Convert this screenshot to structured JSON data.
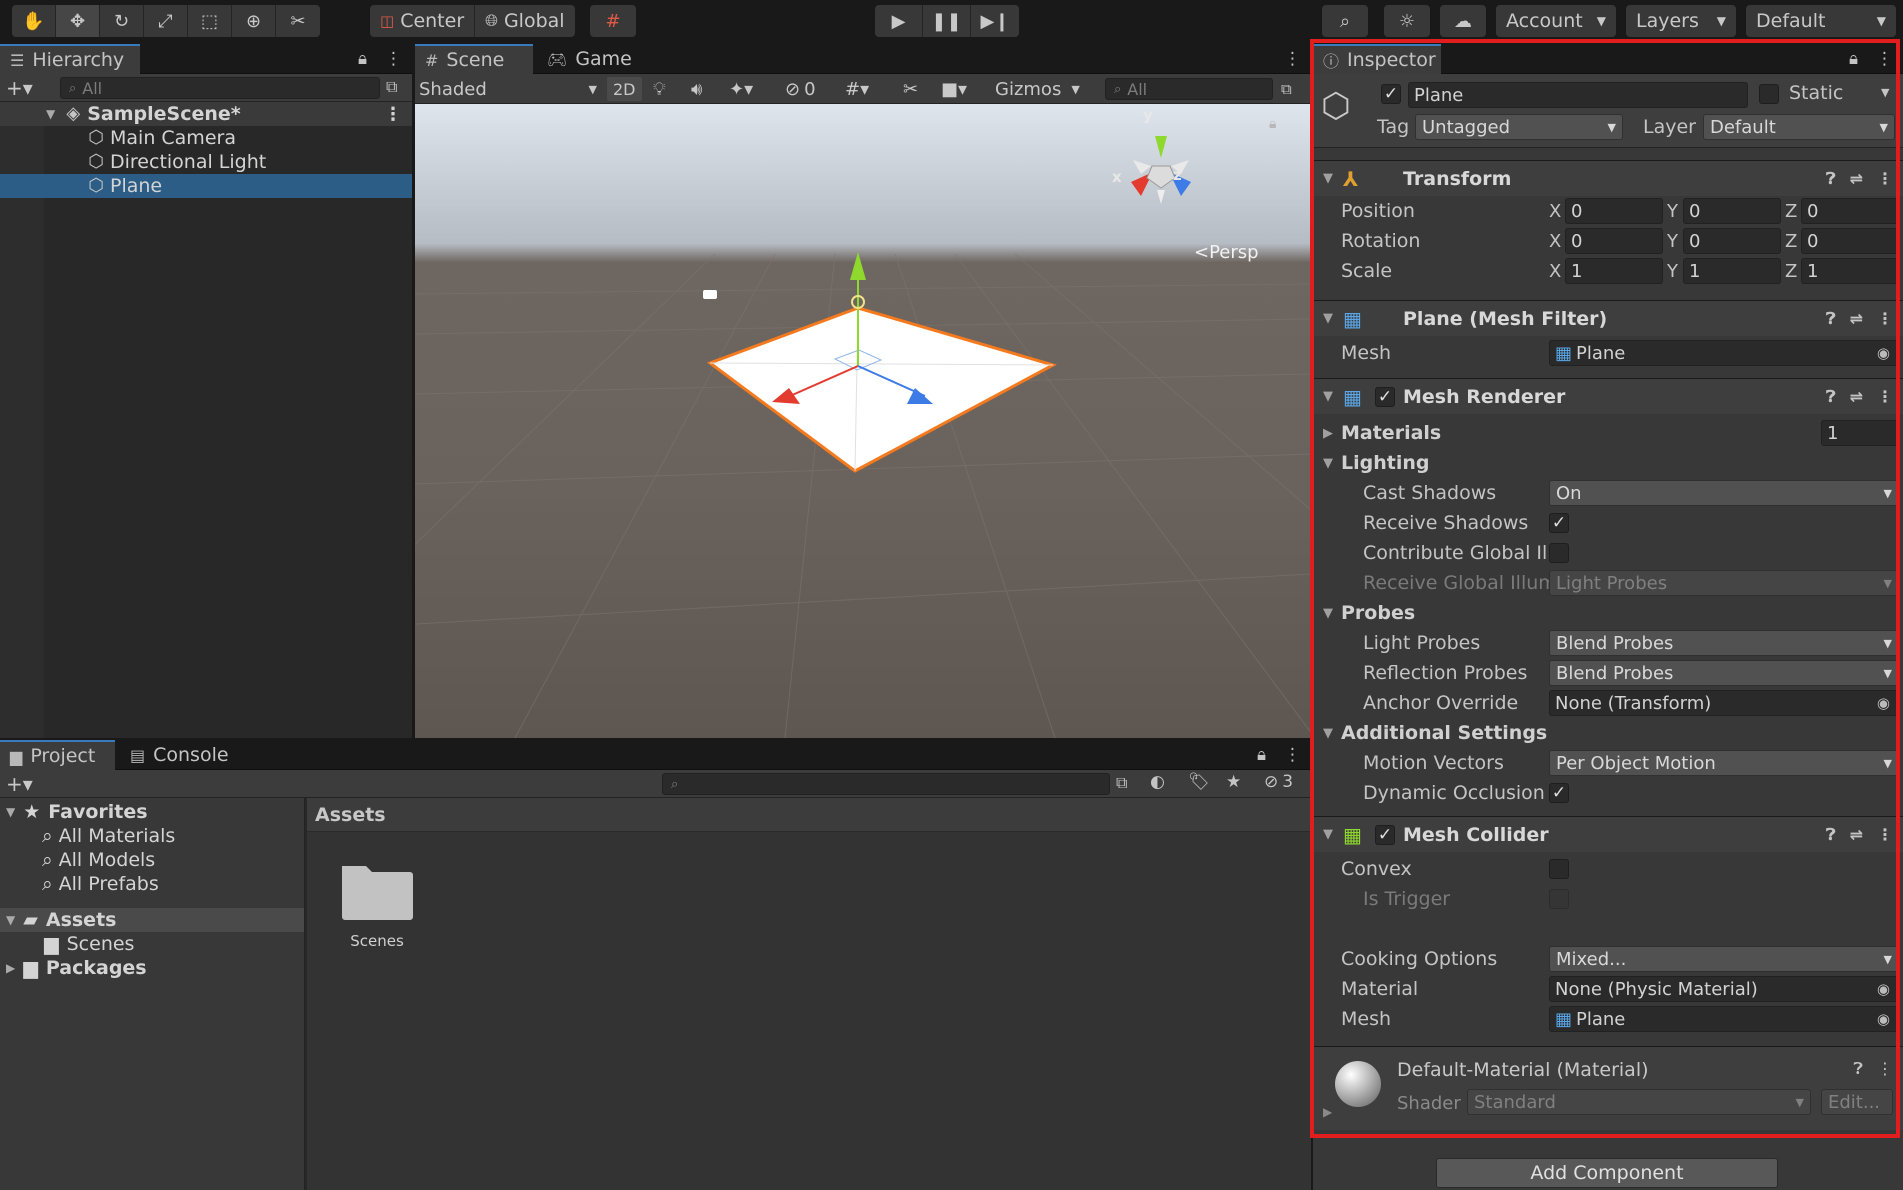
{
  "toolbar": {
    "pivot_label": "Center",
    "space_label": "Global",
    "account_label": "Account",
    "layers_label": "Layers",
    "layout_label": "Default"
  },
  "hierarchy": {
    "tab_label": "Hierarchy",
    "search_placeholder": "All",
    "scene_name": "SampleScene*",
    "items": [
      "Main Camera",
      "Directional Light",
      "Plane"
    ]
  },
  "scene_view": {
    "tabs": [
      "Scene",
      "Game"
    ],
    "shading_mode": "Shaded",
    "mode_2d": "2D",
    "hidden_count": "0",
    "gizmos_label": "Gizmos",
    "search_placeholder": "All",
    "projection_label": "Persp",
    "axis_labels": {
      "x": "x",
      "y": "y",
      "z": "z"
    }
  },
  "project": {
    "tabs": [
      "Project",
      "Console"
    ],
    "favorites_label": "Favorites",
    "favorites": [
      "All Materials",
      "All Models",
      "All Prefabs"
    ],
    "assets_label": "Assets",
    "assets_children": [
      "Scenes"
    ],
    "packages_label": "Packages",
    "breadcrumb": "Assets",
    "hidden_packages_count": "3",
    "folders": [
      "Scenes"
    ]
  },
  "inspector": {
    "tab_label": "Inspector",
    "object_name": "Plane",
    "static_label": "Static",
    "tag_label": "Tag",
    "tag_value": "Untagged",
    "layer_label": "Layer",
    "layer_value": "Default",
    "transform": {
      "title": "Transform",
      "position_label": "Position",
      "rotation_label": "Rotation",
      "scale_label": "Scale",
      "position": [
        "0",
        "0",
        "0"
      ],
      "rotation": [
        "0",
        "0",
        "0"
      ],
      "scale": [
        "1",
        "1",
        "1"
      ],
      "axis": [
        "X",
        "Y",
        "Z"
      ]
    },
    "mesh_filter": {
      "title": "Plane (Mesh Filter)",
      "mesh_label": "Mesh",
      "mesh_value": "Plane"
    },
    "mesh_renderer": {
      "title": "Mesh Renderer",
      "materials_label": "Materials",
      "materials_count": "1",
      "lighting_label": "Lighting",
      "cast_shadows_label": "Cast Shadows",
      "cast_shadows_value": "On",
      "receive_shadows_label": "Receive Shadows",
      "contribute_gi_label": "Contribute Global Illu",
      "receive_gi_label": "Receive Global Illum",
      "receive_gi_value": "Light Probes",
      "probes_label": "Probes",
      "light_probes_label": "Light Probes",
      "light_probes_value": "Blend Probes",
      "reflection_probes_label": "Reflection Probes",
      "reflection_probes_value": "Blend Probes",
      "anchor_override_label": "Anchor Override",
      "anchor_override_value": "None (Transform)",
      "additional_settings_label": "Additional Settings",
      "motion_vectors_label": "Motion Vectors",
      "motion_vectors_value": "Per Object Motion",
      "dynamic_occlusion_label": "Dynamic Occlusion"
    },
    "mesh_collider": {
      "title": "Mesh Collider",
      "convex_label": "Convex",
      "is_trigger_label": "Is Trigger",
      "cooking_options_label": "Cooking Options",
      "cooking_options_value": "Mixed...",
      "material_label": "Material",
      "material_value": "None (Physic Material)",
      "mesh_label": "Mesh",
      "mesh_value": "Plane"
    },
    "material": {
      "title": "Default-Material (Material)",
      "shader_label": "Shader",
      "shader_value": "Standard",
      "edit_label": "Edit..."
    },
    "add_component_label": "Add Component"
  },
  "colors": {
    "selection": "#2c5d87",
    "highlight_border": "#e11d1d",
    "selection_outline": "#f57a1e",
    "axis_x": "#e33b2e",
    "axis_y": "#8fd92e",
    "axis_z": "#3d7be6"
  }
}
